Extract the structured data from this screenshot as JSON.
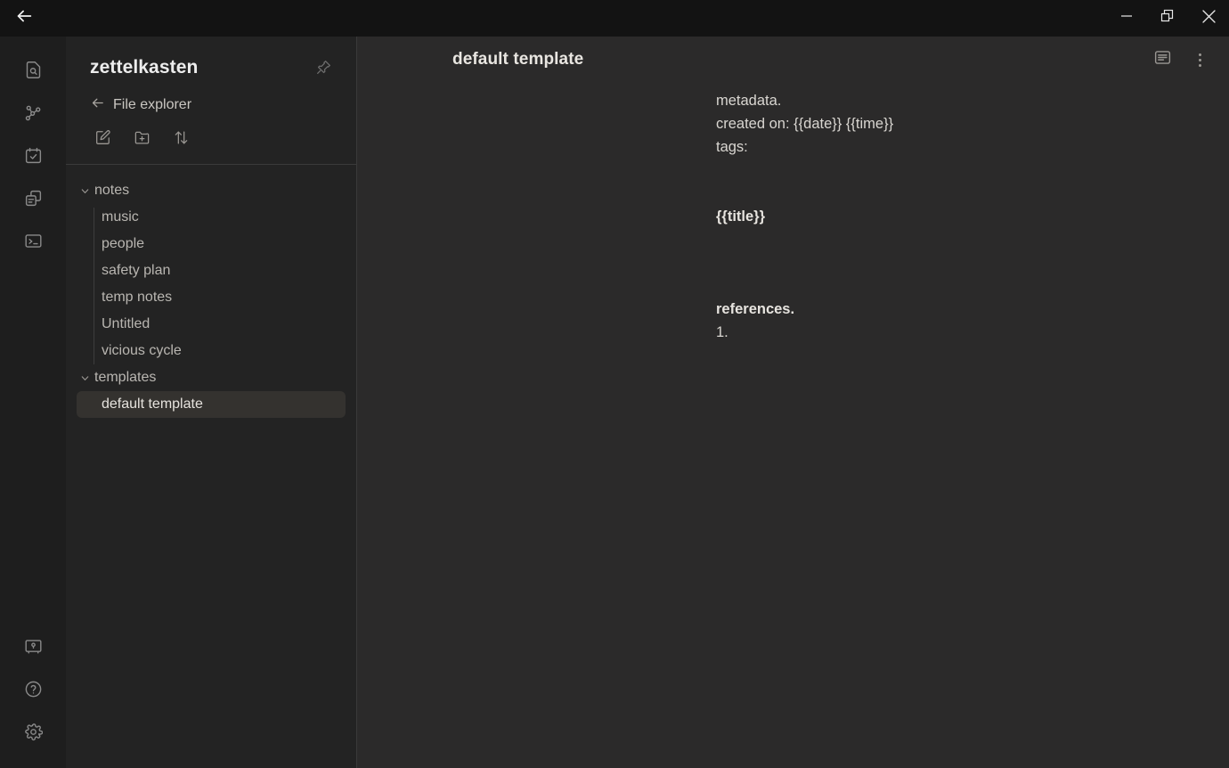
{
  "titlebar": {
    "back_icon": "arrow-left-icon",
    "controls": [
      {
        "name": "minimize",
        "icon": "minimize-icon"
      },
      {
        "name": "restore",
        "icon": "restore-window-icon"
      },
      {
        "name": "close",
        "icon": "close-icon"
      }
    ]
  },
  "rail": {
    "top_items": [
      {
        "name": "search",
        "icon": "file-search-icon"
      },
      {
        "name": "graph",
        "icon": "graph-view-icon"
      },
      {
        "name": "tasks",
        "icon": "calendar-check-icon"
      },
      {
        "name": "clipboard",
        "icon": "copy-stack-icon"
      },
      {
        "name": "terminal",
        "icon": "terminal-icon"
      }
    ],
    "bottom_items": [
      {
        "name": "vault",
        "icon": "safe-vault-icon"
      },
      {
        "name": "help",
        "icon": "question-circle-icon"
      },
      {
        "name": "settings",
        "icon": "gear-icon"
      }
    ]
  },
  "panel": {
    "vault_title": "zettelkasten",
    "pin_icon": "pushpin-icon",
    "breadcrumb": {
      "back_icon": "arrow-left-icon",
      "label": "File explorer"
    },
    "tools": [
      {
        "name": "new-note",
        "icon": "note-edit-icon"
      },
      {
        "name": "new-folder",
        "icon": "folder-plus-icon"
      },
      {
        "name": "sort",
        "icon": "sort-arrows-icon"
      }
    ],
    "tree": [
      {
        "label": "notes",
        "type": "folder",
        "expanded": true,
        "children": [
          {
            "label": "music",
            "type": "file",
            "selected": false
          },
          {
            "label": "people",
            "type": "file",
            "selected": false
          },
          {
            "label": "safety plan",
            "type": "file",
            "selected": false
          },
          {
            "label": "temp notes",
            "type": "file",
            "selected": false
          },
          {
            "label": "Untitled",
            "type": "file",
            "selected": false
          },
          {
            "label": "vicious cycle",
            "type": "file",
            "selected": false
          }
        ]
      },
      {
        "label": "templates",
        "type": "folder",
        "expanded": true,
        "children": [
          {
            "label": "default template",
            "type": "file",
            "selected": true
          }
        ]
      }
    ]
  },
  "editor": {
    "title": "default template",
    "actions": [
      {
        "name": "outline-panel",
        "icon": "text-panel-icon"
      },
      {
        "name": "more-options",
        "icon": "more-vertical-icon"
      }
    ],
    "lines": [
      {
        "text": "metadata.",
        "bold": false
      },
      {
        "text": "created on: {{date}} {{time}}",
        "bold": false
      },
      {
        "text": "tags:",
        "bold": false
      },
      {
        "text": "",
        "bold": false
      },
      {
        "text": "",
        "bold": false
      },
      {
        "text": "{{title}}",
        "bold": true
      },
      {
        "text": "",
        "bold": false
      },
      {
        "text": "",
        "bold": false
      },
      {
        "text": "",
        "bold": false
      },
      {
        "text": "references.",
        "bold": true
      },
      {
        "text": "1.",
        "bold": false
      }
    ]
  },
  "colors": {
    "titlebar_bg": "#131313",
    "rail_bg": "#1e1e1e",
    "panel_bg": "#232323",
    "editor_bg": "#2b2a2a",
    "selection_bg": "#34322f",
    "text_primary": "#d9d6d1",
    "text_muted": "#9a9793"
  }
}
